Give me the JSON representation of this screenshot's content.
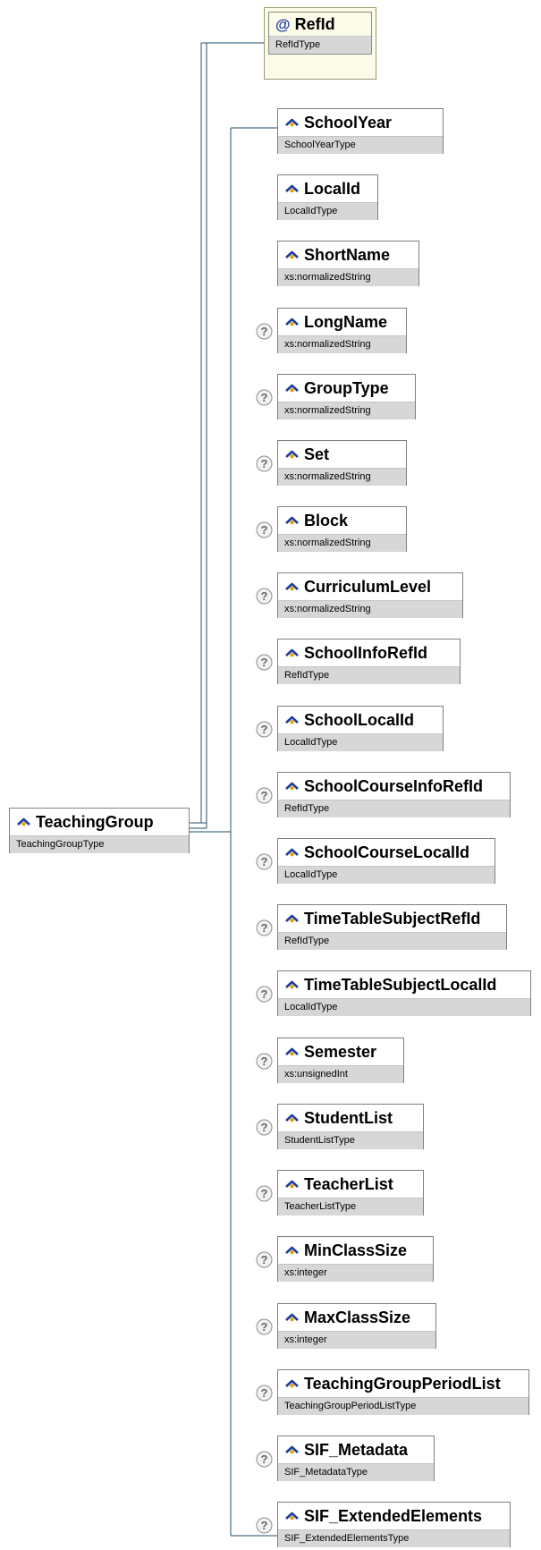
{
  "root": {
    "name": "TeachingGroup",
    "type": "TeachingGroupType",
    "icon": "element-icon"
  },
  "attribute": {
    "name": "RefId",
    "type": "RefIdType",
    "icon": "attribute-at-icon",
    "glyph": "@"
  },
  "children": [
    {
      "name": "SchoolYear",
      "type": "SchoolYearType",
      "optional": false
    },
    {
      "name": "LocalId",
      "type": "LocalIdType",
      "optional": false
    },
    {
      "name": "ShortName",
      "type": "xs:normalizedString",
      "optional": false
    },
    {
      "name": "LongName",
      "type": "xs:normalizedString",
      "optional": true
    },
    {
      "name": "GroupType",
      "type": "xs:normalizedString",
      "optional": true
    },
    {
      "name": "Set",
      "type": "xs:normalizedString",
      "optional": true
    },
    {
      "name": "Block",
      "type": "xs:normalizedString",
      "optional": true
    },
    {
      "name": "CurriculumLevel",
      "type": "xs:normalizedString",
      "optional": true
    },
    {
      "name": "SchoolInfoRefId",
      "type": "RefIdType",
      "optional": true
    },
    {
      "name": "SchoolLocalId",
      "type": "LocalIdType",
      "optional": true
    },
    {
      "name": "SchoolCourseInfoRefId",
      "type": "RefIdType",
      "optional": true
    },
    {
      "name": "SchoolCourseLocalId",
      "type": "LocalIdType",
      "optional": true
    },
    {
      "name": "TimeTableSubjectRefId",
      "type": "RefIdType",
      "optional": true
    },
    {
      "name": "TimeTableSubjectLocalId",
      "type": "LocalIdType",
      "optional": true
    },
    {
      "name": "Semester",
      "type": "xs:unsignedInt",
      "optional": true
    },
    {
      "name": "StudentList",
      "type": "StudentListType",
      "optional": true
    },
    {
      "name": "TeacherList",
      "type": "TeacherListType",
      "optional": true
    },
    {
      "name": "MinClassSize",
      "type": "xs:integer",
      "optional": true
    },
    {
      "name": "MaxClassSize",
      "type": "xs:integer",
      "optional": true
    },
    {
      "name": "TeachingGroupPeriodList",
      "type": "TeachingGroupPeriodListType",
      "optional": true
    },
    {
      "name": "SIF_Metadata",
      "type": "SIF_MetadataType",
      "optional": true
    },
    {
      "name": "SIF_ExtendedElements",
      "type": "SIF_ExtendedElementsType",
      "optional": true
    }
  ],
  "icons": {
    "element": "element-icon",
    "optional": "question-mark-icon",
    "optional_glyph": "?"
  },
  "colors": {
    "wire": "#4a6f86",
    "type_band": "#d7d7d7",
    "attr_bg": "#fbfbe8",
    "icon_blue": "#1e3da0",
    "icon_gold": "#e0a400"
  }
}
